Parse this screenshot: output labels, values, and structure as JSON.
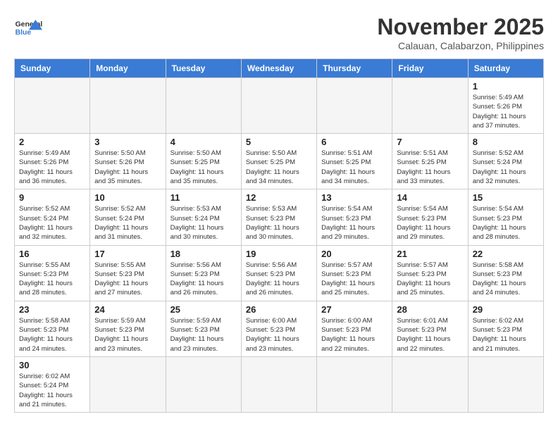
{
  "header": {
    "logo_general": "General",
    "logo_blue": "Blue",
    "month_title": "November 2025",
    "subtitle": "Calauan, Calabarzon, Philippines"
  },
  "weekdays": [
    "Sunday",
    "Monday",
    "Tuesday",
    "Wednesday",
    "Thursday",
    "Friday",
    "Saturday"
  ],
  "weeks": [
    [
      {
        "day": "",
        "empty": true
      },
      {
        "day": "",
        "empty": true
      },
      {
        "day": "",
        "empty": true
      },
      {
        "day": "",
        "empty": true
      },
      {
        "day": "",
        "empty": true
      },
      {
        "day": "",
        "empty": true
      },
      {
        "day": "1",
        "sunrise": "5:49 AM",
        "sunset": "5:26 PM",
        "daylight": "11 hours and 37 minutes."
      }
    ],
    [
      {
        "day": "2",
        "sunrise": "5:49 AM",
        "sunset": "5:26 PM",
        "daylight": "11 hours and 36 minutes."
      },
      {
        "day": "3",
        "sunrise": "5:50 AM",
        "sunset": "5:26 PM",
        "daylight": "11 hours and 35 minutes."
      },
      {
        "day": "4",
        "sunrise": "5:50 AM",
        "sunset": "5:25 PM",
        "daylight": "11 hours and 35 minutes."
      },
      {
        "day": "5",
        "sunrise": "5:50 AM",
        "sunset": "5:25 PM",
        "daylight": "11 hours and 34 minutes."
      },
      {
        "day": "6",
        "sunrise": "5:51 AM",
        "sunset": "5:25 PM",
        "daylight": "11 hours and 34 minutes."
      },
      {
        "day": "7",
        "sunrise": "5:51 AM",
        "sunset": "5:25 PM",
        "daylight": "11 hours and 33 minutes."
      },
      {
        "day": "8",
        "sunrise": "5:52 AM",
        "sunset": "5:24 PM",
        "daylight": "11 hours and 32 minutes."
      }
    ],
    [
      {
        "day": "9",
        "sunrise": "5:52 AM",
        "sunset": "5:24 PM",
        "daylight": "11 hours and 32 minutes."
      },
      {
        "day": "10",
        "sunrise": "5:52 AM",
        "sunset": "5:24 PM",
        "daylight": "11 hours and 31 minutes."
      },
      {
        "day": "11",
        "sunrise": "5:53 AM",
        "sunset": "5:24 PM",
        "daylight": "11 hours and 30 minutes."
      },
      {
        "day": "12",
        "sunrise": "5:53 AM",
        "sunset": "5:23 PM",
        "daylight": "11 hours and 30 minutes."
      },
      {
        "day": "13",
        "sunrise": "5:54 AM",
        "sunset": "5:23 PM",
        "daylight": "11 hours and 29 minutes."
      },
      {
        "day": "14",
        "sunrise": "5:54 AM",
        "sunset": "5:23 PM",
        "daylight": "11 hours and 29 minutes."
      },
      {
        "day": "15",
        "sunrise": "5:54 AM",
        "sunset": "5:23 PM",
        "daylight": "11 hours and 28 minutes."
      }
    ],
    [
      {
        "day": "16",
        "sunrise": "5:55 AM",
        "sunset": "5:23 PM",
        "daylight": "11 hours and 28 minutes."
      },
      {
        "day": "17",
        "sunrise": "5:55 AM",
        "sunset": "5:23 PM",
        "daylight": "11 hours and 27 minutes."
      },
      {
        "day": "18",
        "sunrise": "5:56 AM",
        "sunset": "5:23 PM",
        "daylight": "11 hours and 26 minutes."
      },
      {
        "day": "19",
        "sunrise": "5:56 AM",
        "sunset": "5:23 PM",
        "daylight": "11 hours and 26 minutes."
      },
      {
        "day": "20",
        "sunrise": "5:57 AM",
        "sunset": "5:23 PM",
        "daylight": "11 hours and 25 minutes."
      },
      {
        "day": "21",
        "sunrise": "5:57 AM",
        "sunset": "5:23 PM",
        "daylight": "11 hours and 25 minutes."
      },
      {
        "day": "22",
        "sunrise": "5:58 AM",
        "sunset": "5:23 PM",
        "daylight": "11 hours and 24 minutes."
      }
    ],
    [
      {
        "day": "23",
        "sunrise": "5:58 AM",
        "sunset": "5:23 PM",
        "daylight": "11 hours and 24 minutes."
      },
      {
        "day": "24",
        "sunrise": "5:59 AM",
        "sunset": "5:23 PM",
        "daylight": "11 hours and 23 minutes."
      },
      {
        "day": "25",
        "sunrise": "5:59 AM",
        "sunset": "5:23 PM",
        "daylight": "11 hours and 23 minutes."
      },
      {
        "day": "26",
        "sunrise": "6:00 AM",
        "sunset": "5:23 PM",
        "daylight": "11 hours and 23 minutes."
      },
      {
        "day": "27",
        "sunrise": "6:00 AM",
        "sunset": "5:23 PM",
        "daylight": "11 hours and 22 minutes."
      },
      {
        "day": "28",
        "sunrise": "6:01 AM",
        "sunset": "5:23 PM",
        "daylight": "11 hours and 22 minutes."
      },
      {
        "day": "29",
        "sunrise": "6:02 AM",
        "sunset": "5:23 PM",
        "daylight": "11 hours and 21 minutes."
      }
    ],
    [
      {
        "day": "30",
        "sunrise": "6:02 AM",
        "sunset": "5:24 PM",
        "daylight": "11 hours and 21 minutes."
      },
      {
        "day": "",
        "empty": true
      },
      {
        "day": "",
        "empty": true
      },
      {
        "day": "",
        "empty": true
      },
      {
        "day": "",
        "empty": true
      },
      {
        "day": "",
        "empty": true
      },
      {
        "day": "",
        "empty": true
      }
    ]
  ]
}
